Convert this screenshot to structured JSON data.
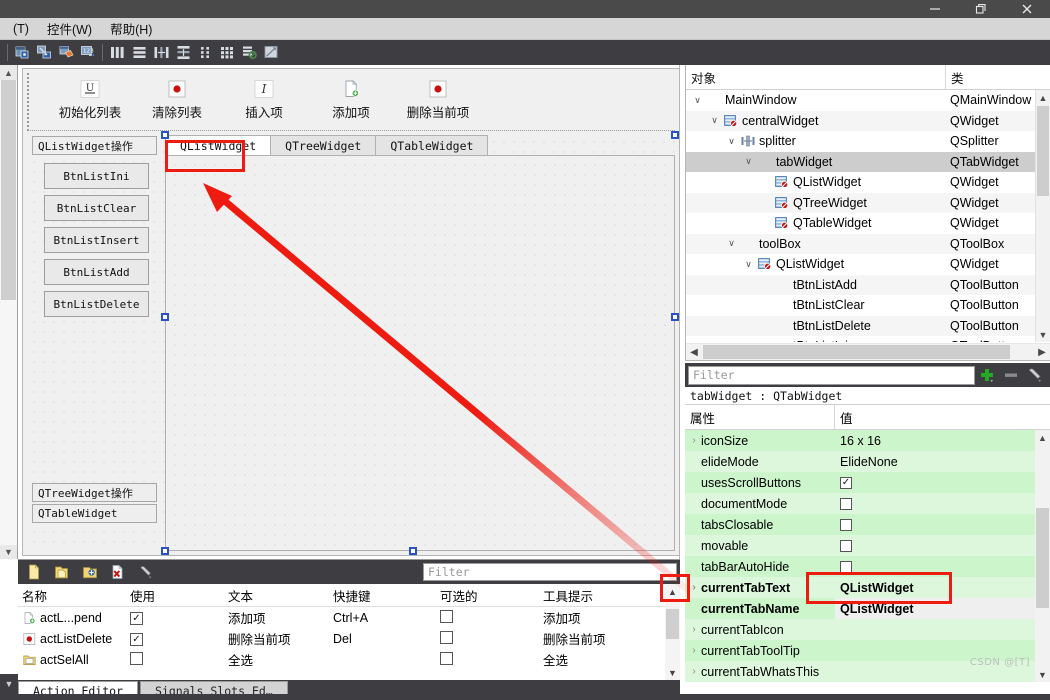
{
  "window": {
    "titlebar_buttons": [
      "minimize",
      "maximize",
      "close"
    ]
  },
  "menubar": {
    "items": [
      {
        "label": "(T)",
        "name": "menu-tools"
      },
      {
        "label": "控件(W)",
        "name": "menu-widgets"
      },
      {
        "label": "帮助(H)",
        "name": "menu-help"
      }
    ]
  },
  "toolbar": {
    "icons": [
      "edit-widgets-icon",
      "edit-signals-slots-icon",
      "edit-buddies-icon",
      "edit-tab-order-icon",
      "layout-horizontal-icon",
      "layout-vertical-icon",
      "layout-splitter-horizontal-icon",
      "layout-splitter-vertical-icon",
      "layout-form-icon",
      "layout-grid-icon",
      "break-layout-icon",
      "adjust-size-icon"
    ]
  },
  "form": {
    "toolbar_buttons": [
      {
        "label": "初始化列表",
        "icon": "underline-u-icon"
      },
      {
        "label": "清除列表",
        "icon": "red-dot-icon"
      },
      {
        "label": "插入项",
        "icon": "italic-i-icon"
      },
      {
        "label": "添加项",
        "icon": "new-document-icon"
      },
      {
        "label": "删除当前项",
        "icon": "red-dot-icon"
      }
    ],
    "toolbox": {
      "header": "QListWidget操作",
      "buttons": [
        "BtnListIni",
        "BtnListClear",
        "BtnListInsert",
        "BtnListAdd",
        "BtnListDelete"
      ],
      "footer_pages": [
        "QTreeWidget操作",
        "QTableWidget"
      ]
    },
    "tabs": [
      {
        "label": "QListWidget",
        "active": true
      },
      {
        "label": "QTreeWidget",
        "active": false
      },
      {
        "label": "QTableWidget",
        "active": false
      }
    ]
  },
  "object_inspector": {
    "columns": [
      "对象",
      "类"
    ],
    "rows": [
      {
        "name": "MainWindow",
        "class": "QMainWindow",
        "indent": 0,
        "chevron": "down",
        "icon": null,
        "selected": false
      },
      {
        "name": "centralWidget",
        "class": "QWidget",
        "indent": 1,
        "chevron": "down",
        "icon": "widget-icon",
        "selected": false
      },
      {
        "name": "splitter",
        "class": "QSplitter",
        "indent": 2,
        "chevron": "down",
        "icon": "splitter-icon",
        "selected": false
      },
      {
        "name": "tabWidget",
        "class": "QTabWidget",
        "indent": 3,
        "chevron": "down",
        "icon": null,
        "selected": true
      },
      {
        "name": "QListWidget",
        "class": "QWidget",
        "indent": 4,
        "chevron": null,
        "icon": "widget-icon",
        "selected": false
      },
      {
        "name": "QTreeWidget",
        "class": "QWidget",
        "indent": 4,
        "chevron": null,
        "icon": "widget-icon",
        "selected": false
      },
      {
        "name": "QTableWidget",
        "class": "QWidget",
        "indent": 4,
        "chevron": null,
        "icon": "widget-icon",
        "selected": false
      },
      {
        "name": "toolBox",
        "class": "QToolBox",
        "indent": 2,
        "chevron": "down",
        "icon": null,
        "selected": false
      },
      {
        "name": "QListWidget",
        "class": "QWidget",
        "indent": 3,
        "chevron": "down",
        "icon": "widget-icon",
        "selected": false
      },
      {
        "name": "tBtnListAdd",
        "class": "QToolButton",
        "indent": 4,
        "chevron": null,
        "icon": null,
        "selected": false
      },
      {
        "name": "tBtnListClear",
        "class": "QToolButton",
        "indent": 4,
        "chevron": null,
        "icon": null,
        "selected": false
      },
      {
        "name": "tBtnListDelete",
        "class": "QToolButton",
        "indent": 4,
        "chevron": null,
        "icon": null,
        "selected": false
      },
      {
        "name": "tBtnListIni",
        "class": "QToolButton",
        "indent": 4,
        "chevron": null,
        "icon": null,
        "selected": false
      }
    ]
  },
  "property_editor": {
    "filter_placeholder": "Filter",
    "toolbar_icons": [
      "add-property-icon",
      "remove-property-icon",
      "configure-icon"
    ],
    "selected_object": "tabWidget : QTabWidget",
    "columns": [
      "属性",
      "值"
    ],
    "rows": [
      {
        "property": "iconSize",
        "value": "16 x 16",
        "chevron": true,
        "type": "text",
        "bold": false
      },
      {
        "property": "elideMode",
        "value": "ElideNone",
        "chevron": false,
        "type": "text",
        "bold": false
      },
      {
        "property": "usesScrollButtons",
        "value": true,
        "chevron": false,
        "type": "checkbox",
        "bold": false
      },
      {
        "property": "documentMode",
        "value": false,
        "chevron": false,
        "type": "checkbox",
        "bold": false
      },
      {
        "property": "tabsClosable",
        "value": false,
        "chevron": false,
        "type": "checkbox",
        "bold": false
      },
      {
        "property": "movable",
        "value": false,
        "chevron": false,
        "type": "checkbox",
        "bold": false
      },
      {
        "property": "tabBarAutoHide",
        "value": false,
        "chevron": false,
        "type": "checkbox",
        "bold": false
      },
      {
        "property": "currentTabText",
        "value": "QListWidget",
        "chevron": true,
        "type": "text",
        "bold": true
      },
      {
        "property": "currentTabName",
        "value": "QListWidget",
        "chevron": false,
        "type": "text",
        "bold": true,
        "grey_value": true
      },
      {
        "property": "currentTabIcon",
        "value": "",
        "chevron": true,
        "type": "text",
        "bold": false
      },
      {
        "property": "currentTabToolTip",
        "value": "",
        "chevron": true,
        "type": "text",
        "bold": false
      },
      {
        "property": "currentTabWhatsThis",
        "value": "",
        "chevron": true,
        "type": "text",
        "bold": false
      }
    ]
  },
  "action_editor": {
    "toolbar_icons": [
      "new-action-icon",
      "copy-action-icon",
      "edit-action-icon",
      "delete-action-icon",
      "configure-icon"
    ],
    "filter_placeholder": "Filter",
    "columns": [
      "名称",
      "使用",
      "文本",
      "快捷键",
      "可选的",
      "工具提示"
    ],
    "rows": [
      {
        "name": "actL...pend",
        "icon": "new-document-icon",
        "used": true,
        "text": "添加项",
        "shortcut": "Ctrl+A",
        "checkable": false,
        "tooltip": "添加项"
      },
      {
        "name": "actListDelete",
        "icon": "red-dot-icon",
        "used": true,
        "text": "删除当前项",
        "shortcut": "Del",
        "checkable": false,
        "tooltip": "删除当前项"
      },
      {
        "name": "actSelAll",
        "icon": "folder-icon",
        "used": false,
        "text": "全选",
        "shortcut": "",
        "checkable": false,
        "tooltip": "全选"
      }
    ],
    "tabs": [
      {
        "label": "Action Editor",
        "active": true
      },
      {
        "label": "Signals  Slots Ed…",
        "active": false
      }
    ]
  },
  "watermark": "CSDN @[T]",
  "colors": {
    "annotation_red": "#ee1b11",
    "property_green": "#ccf5cc",
    "property_green_alt": "#ddf7dd",
    "toolbar_dark": "#3e3e42",
    "titlebar_dark": "#4a4a4a",
    "selection_grey": "#cdcdcd",
    "handle_blue": "#3f6fd8"
  }
}
